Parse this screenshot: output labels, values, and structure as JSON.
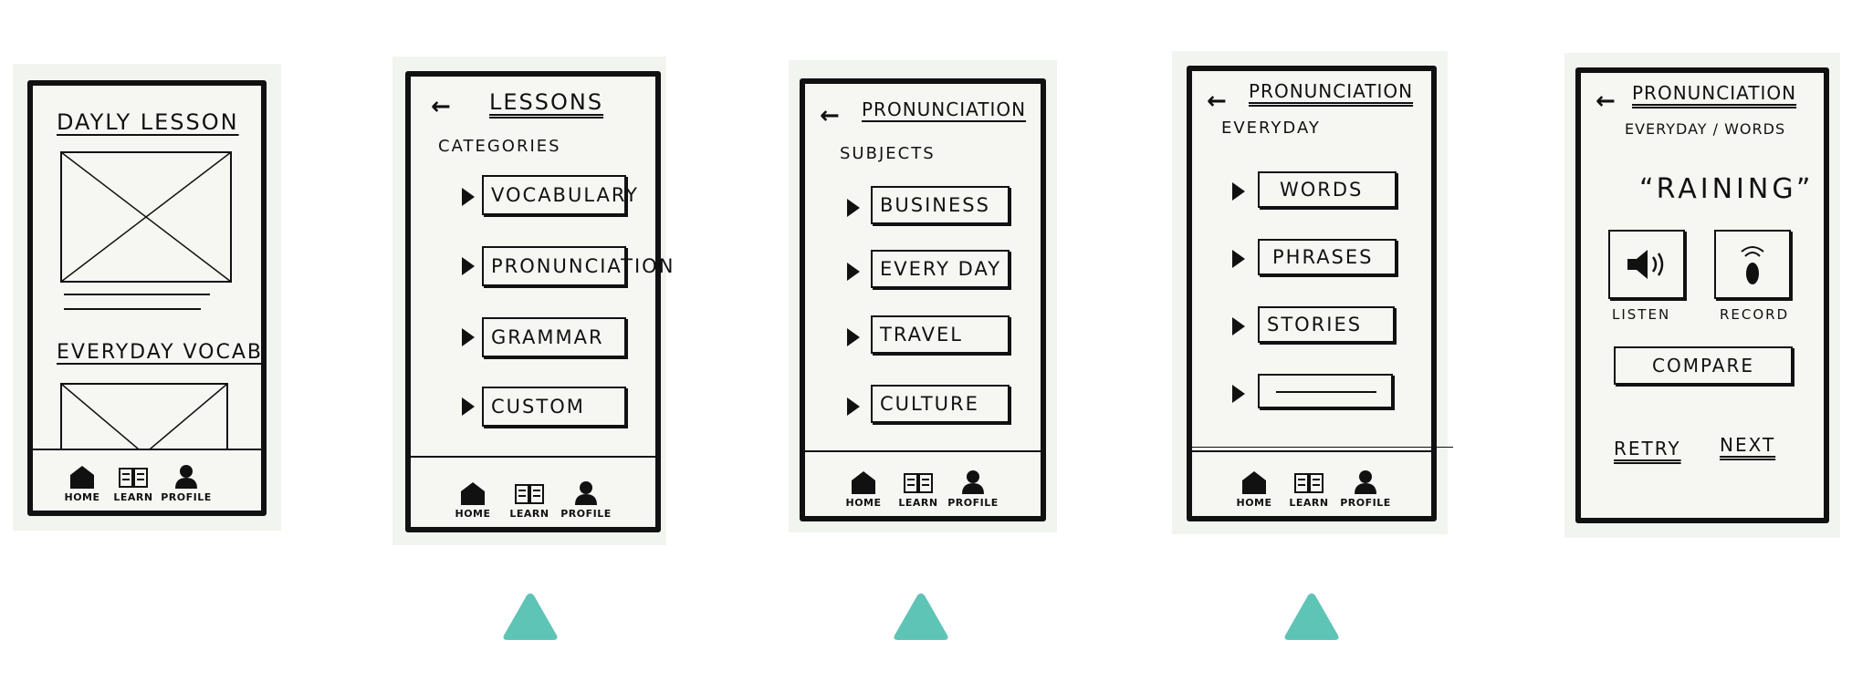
{
  "nav": {
    "home": "HOME",
    "learn": "LEARN",
    "profile": "PROFILE"
  },
  "screen1": {
    "daily_title": "DAYLY LESSON",
    "vocab_title": "EVERYDAY VOCAB"
  },
  "screen2": {
    "title": "LESSONS",
    "subtitle": "CATEGORIES",
    "items": [
      "VOCABULARY",
      "PRONUNCIATION",
      "GRAMMAR",
      "CUSTOM"
    ]
  },
  "screen3": {
    "title": "PRONUNCIATION",
    "subtitle": "SUBJECTS",
    "items": [
      "BUSINESS",
      "EVERY DAY",
      "TRAVEL",
      "CULTURE"
    ]
  },
  "screen4": {
    "title": "PRONUNCIATION",
    "subtitle": "EVERYDAY",
    "items": [
      "WORDS",
      "PHRASES",
      "STORIES"
    ]
  },
  "screen5": {
    "title": "PRONUNCIATION",
    "subtitle": "EVERYDAY / WORDS",
    "word": "“RAINING”",
    "listen": "LISTEN",
    "record": "RECORD",
    "compare": "COMPARE",
    "retry": "RETRY",
    "next": "NEXT"
  },
  "colors": {
    "pointer": "#5ec4b6",
    "ink": "#111111",
    "paper": "#f2f4f0"
  }
}
